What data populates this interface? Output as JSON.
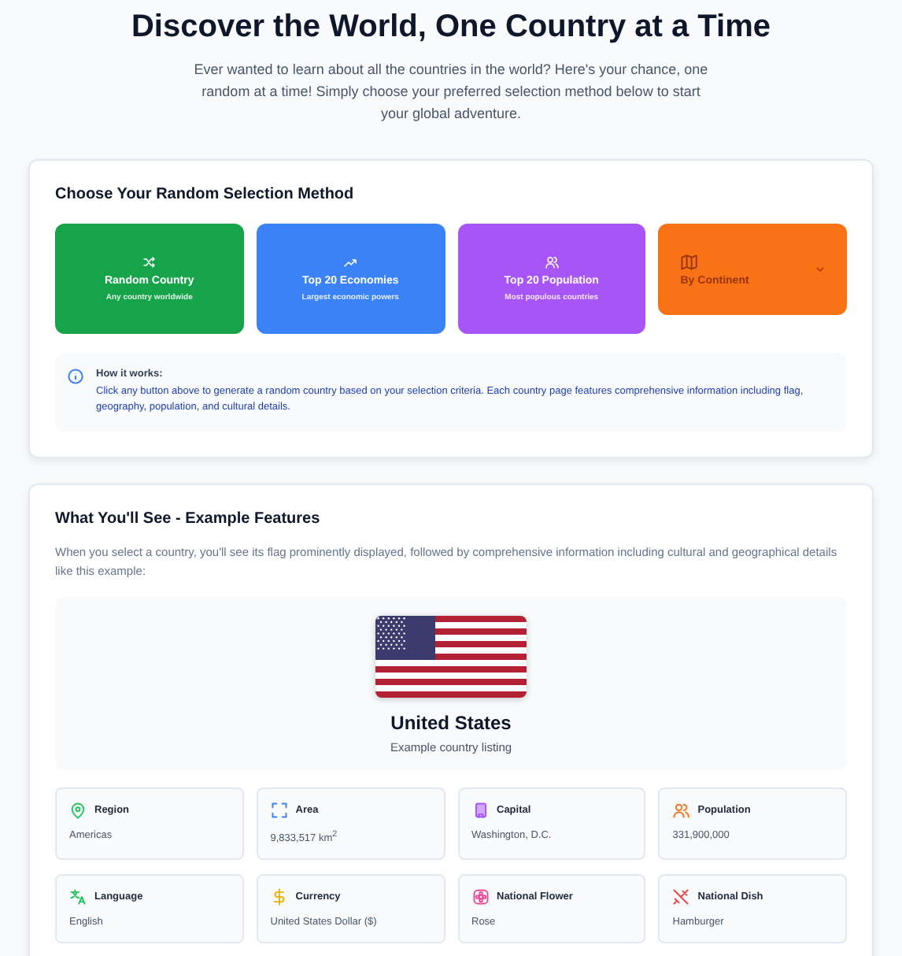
{
  "header": {
    "title": "Discover the World, One Country at a Time",
    "subtitle": "Ever wanted to learn about all the countries in the world? Here's your chance, one random at a time! Simply choose your preferred selection method below to start your global adventure."
  },
  "selection": {
    "title": "Choose Your Random Selection Method",
    "buttons": [
      {
        "kind": "button",
        "label": "Random Country",
        "sublabel": "Any country worldwide",
        "color": "#16a34a"
      },
      {
        "kind": "button",
        "label": "Top 20 Economies",
        "sublabel": "Largest economic powers",
        "color": "#3b82f6"
      },
      {
        "kind": "button",
        "label": "Top 20 Population",
        "sublabel": "Most populous countries",
        "color": "#a855f7"
      },
      {
        "kind": "dropdown",
        "label": "By Continent",
        "color": "#f97316"
      }
    ],
    "note": {
      "title": "How it works:",
      "text": "Click any button above to generate a random country based on your selection criteria. Each country page features comprehensive information including flag, geography, population, and cultural details."
    }
  },
  "example": {
    "title": "What You'll See - Example Features",
    "intro": "When you select a country, you'll see its flag prominently displayed, followed by comprehensive information including cultural and geographical details like this example:",
    "country": "United States",
    "caption": "Example country listing",
    "facts": [
      {
        "label": "Region",
        "value": "Americas"
      },
      {
        "label": "Area",
        "value": "9,833,517 km$^{2}$"
      },
      {
        "label": "Capital",
        "value": "Washington, D.C."
      },
      {
        "label": "Population",
        "value": "331,900,000"
      },
      {
        "label": "Language",
        "value": "English"
      },
      {
        "label": "Currency",
        "value": "United States Dollar ($)"
      },
      {
        "label": "National Flower",
        "value": "Rose"
      },
      {
        "label": "National Dish",
        "value": "Hamburger"
      }
    ]
  }
}
